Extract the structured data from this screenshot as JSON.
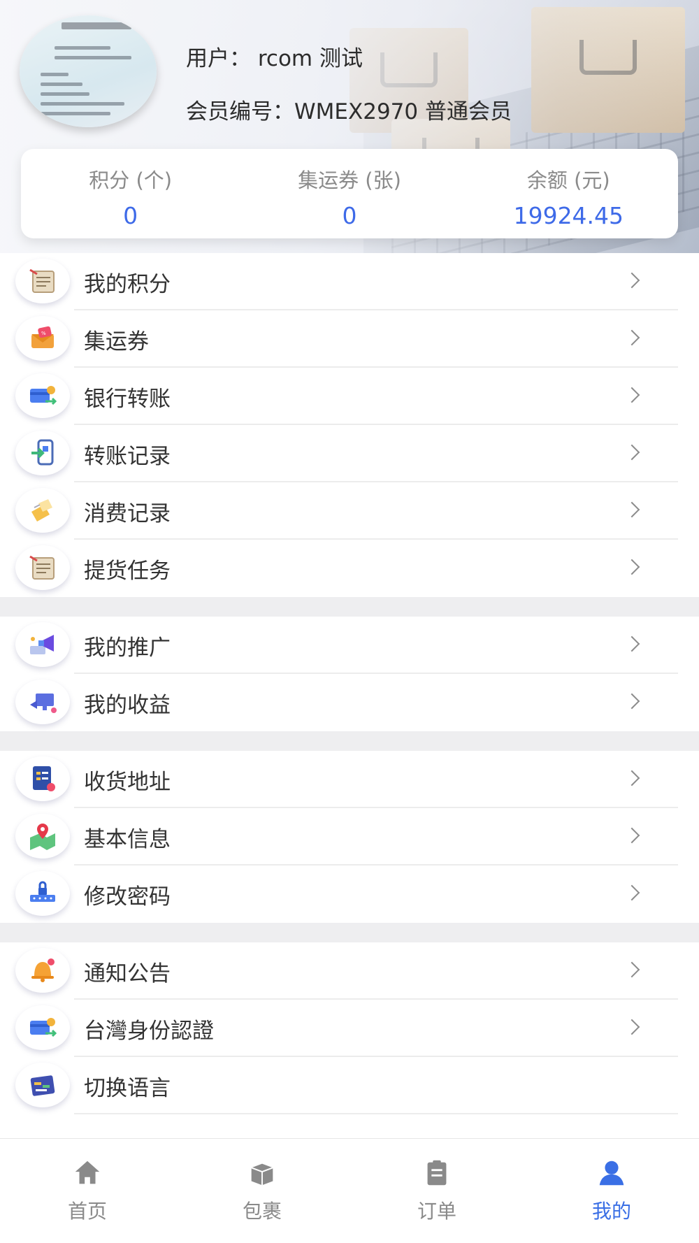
{
  "header": {
    "user_label": "用户： rcom 测试",
    "member_label": "会员编号：WMEX2970 普通会员"
  },
  "stats": [
    {
      "label": "积分 (个)",
      "value": "0"
    },
    {
      "label": "集运券 (张)",
      "value": "0"
    },
    {
      "label": "余额 (元)",
      "value": "19924.45"
    }
  ],
  "menu": {
    "group1": [
      {
        "label": "我的积分",
        "icon": "notepad-icon"
      },
      {
        "label": "集运券",
        "icon": "coupon-icon"
      },
      {
        "label": "银行转账",
        "icon": "bank-card-icon"
      },
      {
        "label": "转账记录",
        "icon": "transfer-record-icon"
      },
      {
        "label": "消费记录",
        "icon": "folder-icon"
      },
      {
        "label": "提货任务",
        "icon": "notepad-icon"
      }
    ],
    "group2": [
      {
        "label": "我的推广",
        "icon": "megaphone-icon"
      },
      {
        "label": "我的收益",
        "icon": "earnings-icon"
      }
    ],
    "group3": [
      {
        "label": "收货地址",
        "icon": "address-list-icon"
      },
      {
        "label": "基本信息",
        "icon": "map-pin-icon"
      },
      {
        "label": "修改密码",
        "icon": "lock-icon"
      }
    ],
    "group4": [
      {
        "label": "通知公告",
        "icon": "bell-icon"
      },
      {
        "label": "台灣身份認證",
        "icon": "id-card-icon"
      },
      {
        "label": "切换语言",
        "icon": "language-icon"
      }
    ]
  },
  "tabbar": [
    {
      "label": "首页",
      "icon": "home-icon",
      "active": false
    },
    {
      "label": "包裹",
      "icon": "package-icon",
      "active": false
    },
    {
      "label": "订单",
      "icon": "order-icon",
      "active": false
    },
    {
      "label": "我的",
      "icon": "user-icon",
      "active": true
    }
  ],
  "colors": {
    "accent": "#3e6ae8",
    "tab_active": "#3a6fe5",
    "text_primary": "#333333",
    "text_secondary": "#8a8a8a",
    "separator": "#eeeef0"
  }
}
